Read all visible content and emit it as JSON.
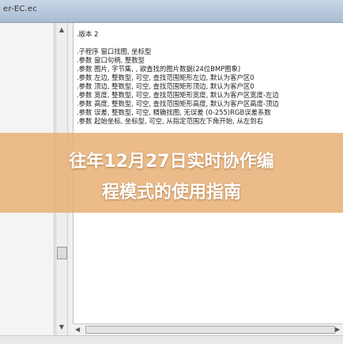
{
  "window": {
    "title": "er-EC.ec"
  },
  "editor": {
    "lines": [
      ".版本 2",
      "",
      ".子程序 窗口找图, 坐标型",
      ".参数 窗口句柄, 整数型",
      ".参数 图片, 字节集, , 欲查找的图片数据(24位BMP图象)",
      ".参数 左边, 整数型, 可空, 查找范围矩形左边, 默认为客户区0",
      ".参数 顶边, 整数型, 可空, 查找范围矩形顶边, 默认为客户区0",
      ".参数 宽度, 整数型, 可空, 查找范围矩形宽度, 默认为客户区宽度-左边",
      ".参数 高度, 整数型, 可空, 查找范围矩形高度, 默认为客户区高度-顶边",
      ".参数 误差, 整数型, 可空, 精确找图, 无误差 (0-255)RGB误差系数",
      ".参数 起始坐标, 坐标型, 可空, 从指定范围左下角开始, 从左到右"
    ]
  },
  "banner": {
    "line1": "往年12月27日实时协作编",
    "line2": "程模式的使用指南"
  },
  "icons": {
    "scroll_up": "scroll-up-arrow-icon",
    "scroll_down": "scroll-down-arrow-icon",
    "scroll_left": "scroll-left-arrow-icon",
    "scroll_right": "scroll-right-arrow-icon"
  },
  "colors": {
    "banner_bg": "#e8b076",
    "banner_text": "#ffffff",
    "titlebar": "#b9c9dc"
  }
}
